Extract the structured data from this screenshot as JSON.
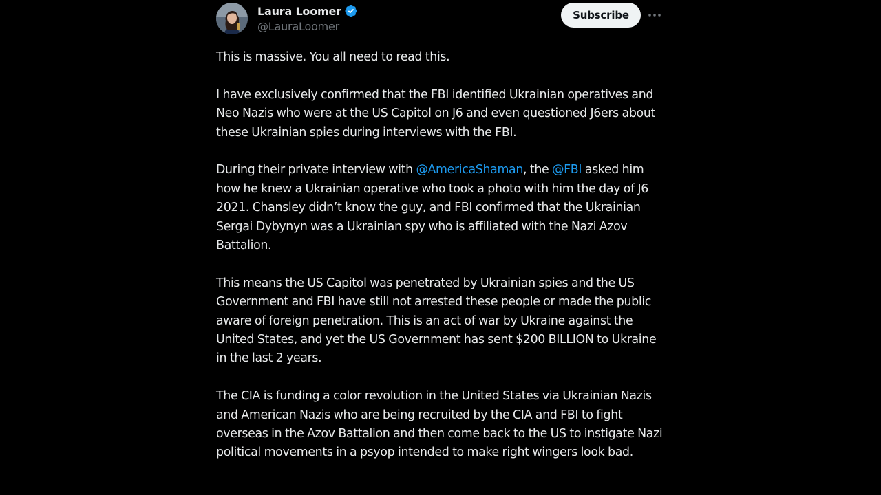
{
  "author": {
    "display_name": "Laura Loomer",
    "handle": "@LauraLoomer",
    "verified_icon": "verified-badge-icon",
    "avatar_icon": "avatar"
  },
  "actions": {
    "subscribe_label": "Subscribe",
    "more_icon": "more-icon"
  },
  "colors": {
    "background": "#000000",
    "text": "#e7e9ea",
    "secondary": "#71767b",
    "link": "#1d9bf0",
    "button_bg": "#eff3f4"
  },
  "post": {
    "p1": "This is massive. You all need to read this.",
    "p2": "I have exclusively confirmed that the FBI identified Ukrainian operatives and Neo Nazis who were at the US Capitol on J6 and even questioned J6ers about these Ukrainian spies during interviews with the FBI.",
    "p3_pre": "During their private interview with ",
    "p3_mention1": "@AmericaShaman",
    "p3_mid": ", the ",
    "p3_mention2": "@FBI",
    "p3_post": " asked him how he knew a Ukrainian operative who took a photo with him the day of J6 2021. Chansley didn’t know the guy, and FBI confirmed that the Ukrainian Sergai Dybynyn was a Ukrainian spy who is affiliated with the Nazi Azov Battalion.",
    "p4": "This means the US Capitol was penetrated by Ukrainian spies and the US Government and FBI have still not arrested these people or made the public aware of foreign penetration. This is an act of war by Ukraine against the United States, and yet the US Government has sent $200 BILLION to Ukraine in the last 2 years.",
    "p5": "The CIA is funding a color revolution in the United States via Ukrainian Nazis and American Nazis who are being recruited by the CIA and FBI to fight overseas in the Azov Battalion and then come back to the US to instigate Nazi political movements in a psyop intended to make right wingers look bad."
  }
}
